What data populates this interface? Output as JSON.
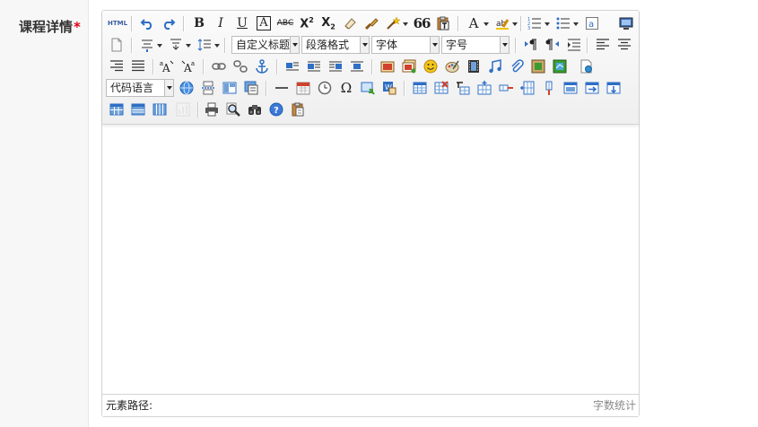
{
  "field": {
    "label": "课程详情",
    "required_mark": "*"
  },
  "toolbar": {
    "html_label": "HTML",
    "bold": "B",
    "italic": "I",
    "underline": "U",
    "border_text": "A",
    "strike": "ABC",
    "superscript": "X",
    "superscript_sup": "2",
    "subscript": "X",
    "subscript_sub": "2",
    "quote": "66",
    "fontcolor": "A",
    "custom_title": "自定义标题",
    "paragraph": "段落格式",
    "font_family": "字体",
    "font_size": "字号",
    "omega": "Ω",
    "code_language": "代码语言"
  },
  "statusbar": {
    "path_label": "元素路径:",
    "word_count": "字数统计"
  }
}
